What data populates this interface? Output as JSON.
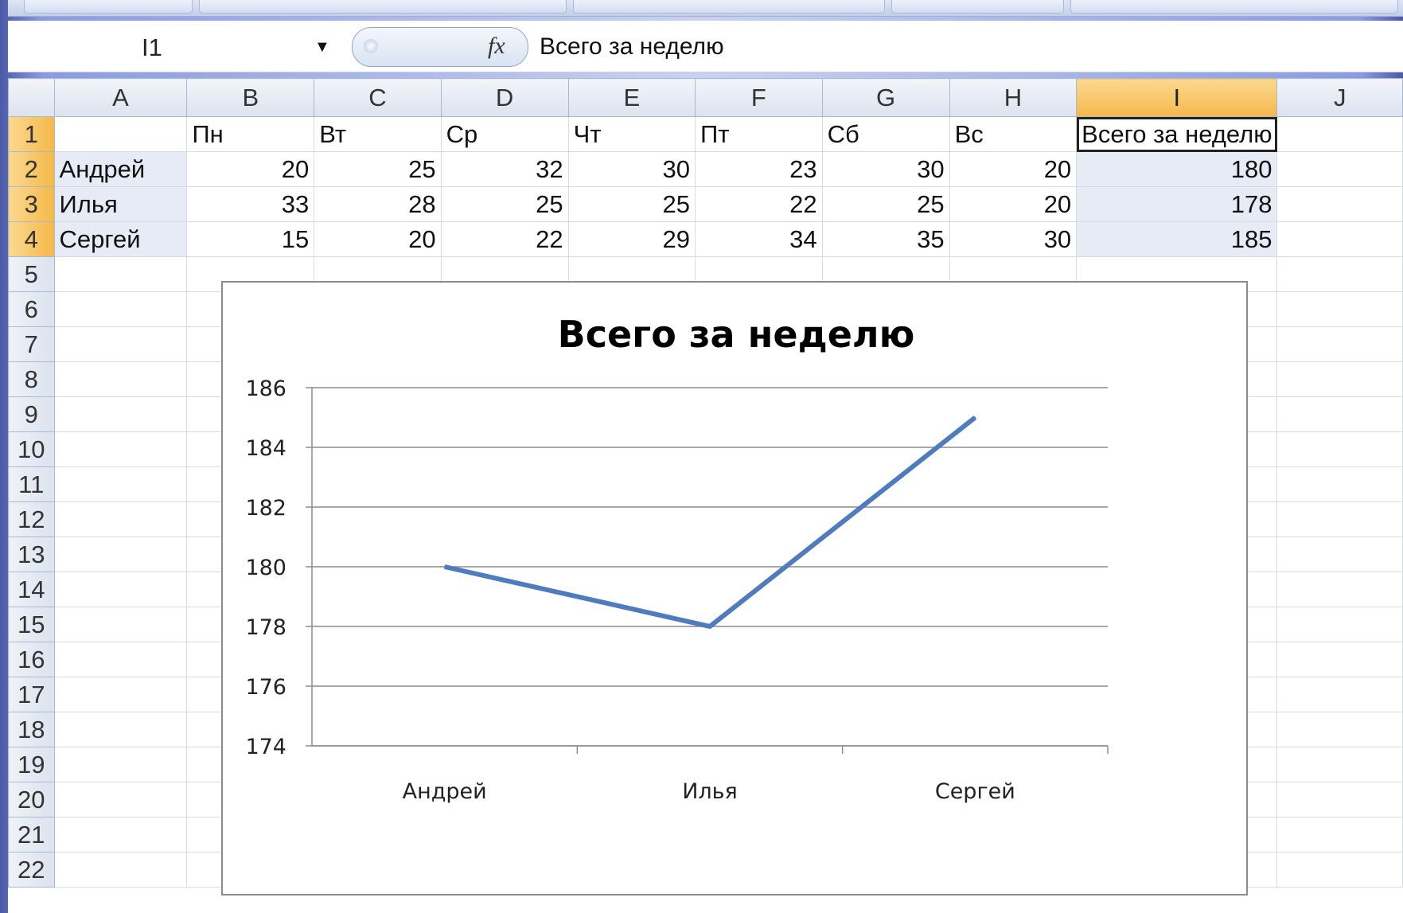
{
  "formula_bar": {
    "name_box": "I1",
    "fx_label": "fx",
    "formula": "Всего за неделю"
  },
  "sheet": {
    "columns": [
      "A",
      "B",
      "C",
      "D",
      "E",
      "F",
      "G",
      "H",
      "I",
      "J"
    ],
    "selected_column": "I",
    "rows": [
      {
        "n": "1",
        "cells": [
          "",
          "Пн",
          "Вт",
          "Ср",
          "Чт",
          "Пт",
          "Сб",
          "Вс",
          "Всего за неделю",
          ""
        ]
      },
      {
        "n": "2",
        "cells": [
          "Андрей",
          "20",
          "25",
          "32",
          "30",
          "23",
          "30",
          "20",
          "180",
          ""
        ]
      },
      {
        "n": "3",
        "cells": [
          "Илья",
          "33",
          "28",
          "25",
          "25",
          "22",
          "25",
          "20",
          "178",
          ""
        ]
      },
      {
        "n": "4",
        "cells": [
          "Сергей",
          "15",
          "20",
          "22",
          "29",
          "34",
          "35",
          "30",
          "185",
          ""
        ]
      },
      {
        "n": "5",
        "cells": [
          "",
          "",
          "",
          "",
          "",
          "",
          "",
          "",
          "",
          ""
        ]
      },
      {
        "n": "6",
        "cells": [
          "",
          "",
          "",
          "",
          "",
          "",
          "",
          "",
          "",
          ""
        ]
      },
      {
        "n": "7",
        "cells": [
          "",
          "",
          "",
          "",
          "",
          "",
          "",
          "",
          "",
          ""
        ]
      },
      {
        "n": "8",
        "cells": [
          "",
          "",
          "",
          "",
          "",
          "",
          "",
          "",
          "",
          ""
        ]
      },
      {
        "n": "9",
        "cells": [
          "",
          "",
          "",
          "",
          "",
          "",
          "",
          "",
          "",
          ""
        ]
      },
      {
        "n": "10",
        "cells": [
          "",
          "",
          "",
          "",
          "",
          "",
          "",
          "",
          "",
          ""
        ]
      },
      {
        "n": "11",
        "cells": [
          "",
          "",
          "",
          "",
          "",
          "",
          "",
          "",
          "",
          ""
        ]
      },
      {
        "n": "12",
        "cells": [
          "",
          "",
          "",
          "",
          "",
          "",
          "",
          "",
          "",
          ""
        ]
      },
      {
        "n": "13",
        "cells": [
          "",
          "",
          "",
          "",
          "",
          "",
          "",
          "",
          "",
          ""
        ]
      },
      {
        "n": "14",
        "cells": [
          "",
          "",
          "",
          "",
          "",
          "",
          "",
          "",
          "",
          ""
        ]
      },
      {
        "n": "15",
        "cells": [
          "",
          "",
          "",
          "",
          "",
          "",
          "",
          "",
          "",
          ""
        ]
      },
      {
        "n": "16",
        "cells": [
          "",
          "",
          "",
          "",
          "",
          "",
          "",
          "",
          "",
          ""
        ]
      },
      {
        "n": "17",
        "cells": [
          "",
          "",
          "",
          "",
          "",
          "",
          "",
          "",
          "",
          ""
        ]
      },
      {
        "n": "18",
        "cells": [
          "",
          "",
          "",
          "",
          "",
          "",
          "",
          "",
          "",
          ""
        ]
      },
      {
        "n": "19",
        "cells": [
          "",
          "",
          "",
          "",
          "",
          "",
          "",
          "",
          "",
          ""
        ]
      },
      {
        "n": "20",
        "cells": [
          "",
          "",
          "",
          "",
          "",
          "",
          "",
          "",
          "",
          ""
        ]
      },
      {
        "n": "21",
        "cells": [
          "",
          "",
          "",
          "",
          "",
          "",
          "",
          "",
          "",
          ""
        ]
      },
      {
        "n": "22",
        "cells": [
          "",
          "",
          "",
          "",
          "",
          "",
          "",
          "",
          "",
          ""
        ]
      }
    ]
  },
  "colors": {
    "series_line": "#4f7bbf",
    "selected_header": "#f5b84a",
    "gridline": "#8c8c8c"
  },
  "chart_data": {
    "type": "line",
    "title": "Всего за неделю",
    "categories": [
      "Андрей",
      "Илья",
      "Сергей"
    ],
    "series": [
      {
        "values": [
          180,
          178,
          185
        ]
      }
    ],
    "ylim": [
      174,
      186
    ],
    "yticks": [
      "174",
      "176",
      "178",
      "180",
      "182",
      "184",
      "186"
    ],
    "grid": true,
    "legend": "none"
  }
}
